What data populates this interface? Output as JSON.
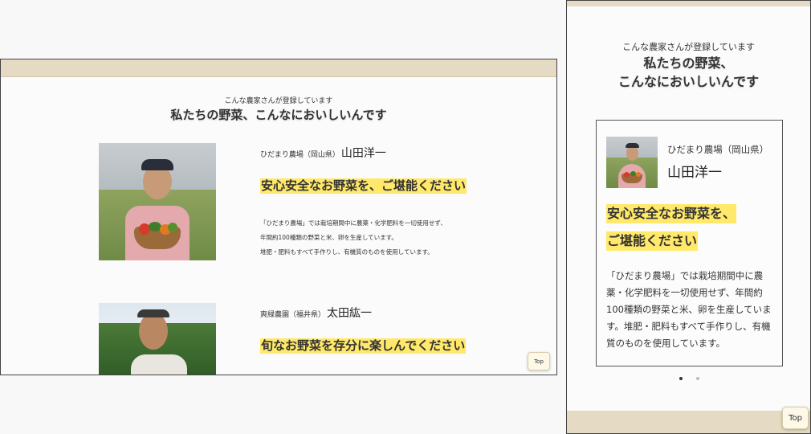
{
  "section": {
    "eyebrow": "こんな農家さんが登録しています",
    "heading": "私たちの野菜、こんなにおいしいんです",
    "heading_line1": "私たちの野菜、",
    "heading_line2": "こんなにおいしいんです"
  },
  "farmers": [
    {
      "farm": "ひだまり農場（岡山県）",
      "name": "山田洋一",
      "catch": "安心安全なお野菜を、ご堪能ください",
      "catch_line1": "安心安全なお野菜を、",
      "catch_line2": "ご堪能ください",
      "desc_lines": [
        "「ひだまり農場」では栽培期間中に農薬・化学肥料を一切使用せず、",
        "年間約100種類の野菜と米、卵を生産しています。",
        "堆肥・肥料もすべて手作りし、有機質のものを使用しています。"
      ],
      "desc_full": "「ひだまり農場」では栽培期間中に農薬・化学肥料を一切使用せず、年間約100種類の野菜と米、卵を生産しています。堆肥・肥料もすべて手作りし、有機質のものを使用しています。"
    },
    {
      "farm": "爽緑農園（福井県）",
      "name": "太田紘一",
      "catch": "旬なお野菜を存分に楽しんでください"
    }
  ],
  "buttons": {
    "top_label": "Top"
  },
  "carousel": {
    "active_index": 0,
    "count": 2
  },
  "colors": {
    "accent_bar": "#e5dac3",
    "highlight": "#ffe86a",
    "dot_active": "#333333",
    "dot_inactive": "#bbbbbb"
  }
}
